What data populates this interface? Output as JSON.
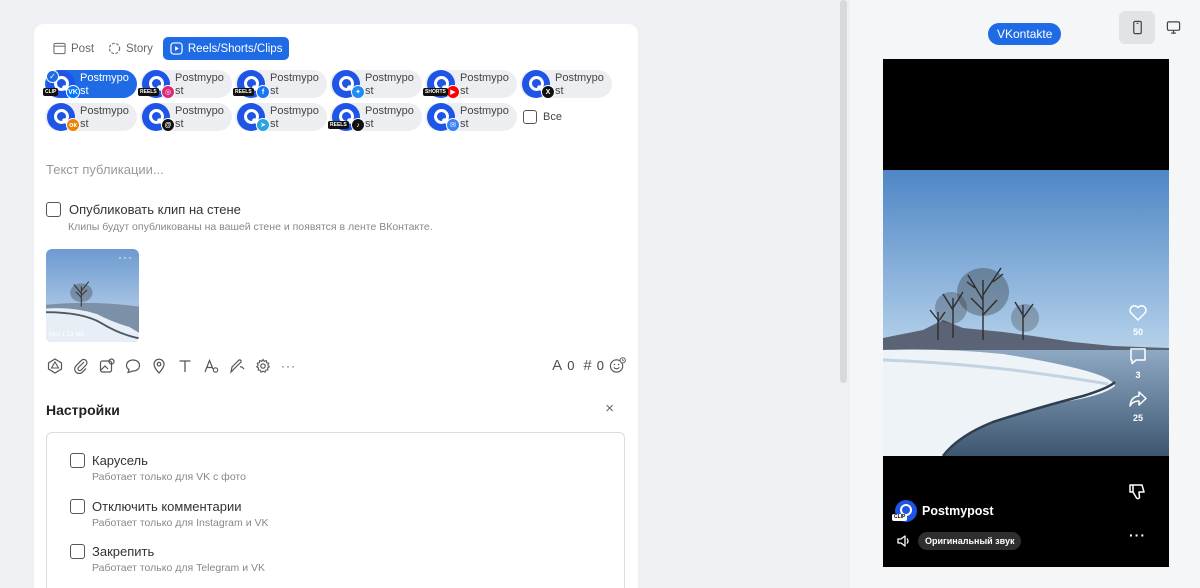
{
  "tabs": [
    {
      "label": "Post",
      "icon": "post-icon"
    },
    {
      "label": "Story",
      "icon": "story-icon"
    },
    {
      "label": "Reels/Shorts/Clips",
      "icon": "reels-icon",
      "active": true
    }
  ],
  "accounts": [
    {
      "name": "Postmypost",
      "network": "vk",
      "kind": "CLIP",
      "selected": true
    },
    {
      "name": "Postmypost",
      "network": "instagram",
      "kind": "REELS"
    },
    {
      "name": "Postmypost",
      "network": "facebook",
      "kind": "REELS"
    },
    {
      "name": "Postmypost",
      "network": "bluesky"
    },
    {
      "name": "Postmypost",
      "network": "youtube",
      "kind": "SHORTS"
    },
    {
      "name": "Postmypost",
      "network": "x"
    },
    {
      "name": "Postmypost",
      "network": "odnoklassniki"
    },
    {
      "name": "Postmypost",
      "network": "threads"
    },
    {
      "name": "Postmypost",
      "network": "telegram"
    },
    {
      "name": "Postmypost",
      "network": "tiktok",
      "kind": "REELS"
    },
    {
      "name": "Postmypost",
      "network": "vk-messenger"
    }
  ],
  "select_all_label": "Все",
  "post_text_placeholder": "Текст публикации...",
  "publish_on_wall": {
    "label": "Опубликовать клип на стене",
    "hint": "Клипы будут опубликованы на вашей стене и появятся в ленте ВКонтакте."
  },
  "media": {
    "meta": "Mov 1.13 Mb",
    "menu": "···"
  },
  "toolbar_more": "···",
  "counters": {
    "chars": "0",
    "hashtags": "0"
  },
  "settings": {
    "title": "Настройки",
    "close": "×",
    "options": [
      {
        "label": "Карусель",
        "hint": "Работает только для VK с фото"
      },
      {
        "label": "Отключить комментарии",
        "hint": "Работает только для Instagram и VK"
      },
      {
        "label": "Закрепить",
        "hint": "Работает только для Telegram и VK"
      }
    ]
  },
  "preview": {
    "network_label": "VKontakte",
    "likes": "50",
    "comments": "3",
    "shares": "25",
    "channel_name": "Postmypost",
    "channel_kind": "CLIP",
    "sound_label": "Оригинальный звук",
    "more": "···"
  },
  "colors": {
    "accent": "#1f6be6",
    "vk": "#0077ff",
    "instagram": "#d62976",
    "facebook": "#1877f2",
    "bluesky": "#1d8cf8",
    "youtube": "#ff0000",
    "x": "#111111",
    "odnoklassniki": "#ee8208",
    "threads": "#111111",
    "telegram": "#2aa3df",
    "tiktok": "#111111",
    "vk-messenger": "#3b82f6"
  }
}
